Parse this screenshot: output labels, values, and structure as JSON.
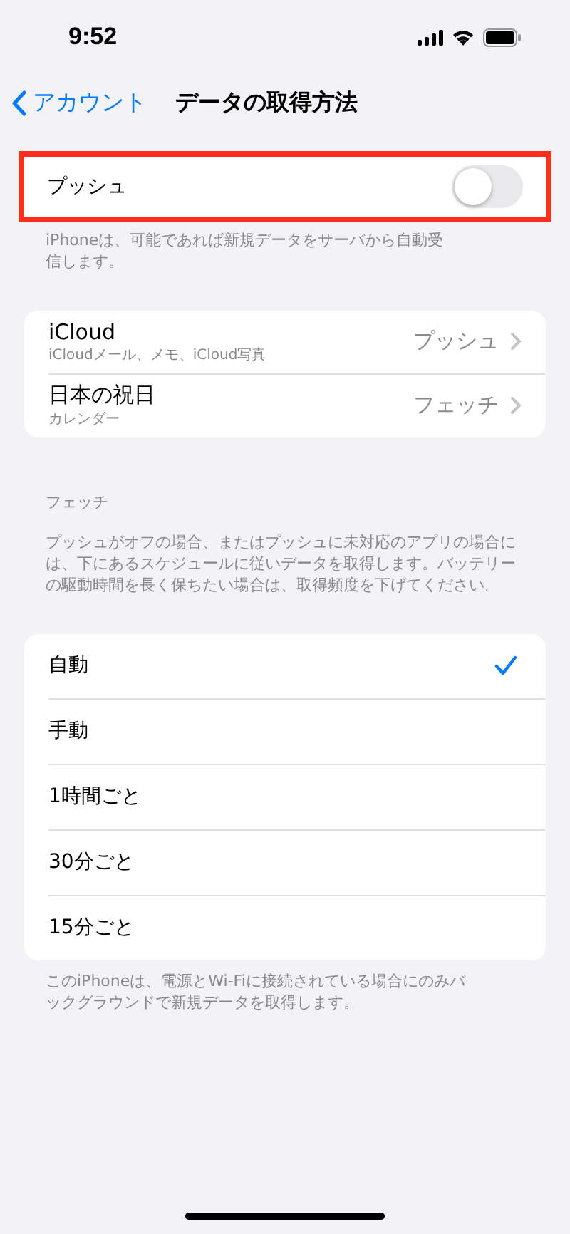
{
  "status_bar": {
    "time": "9:52"
  },
  "nav": {
    "back": "アカウント",
    "title": "データの取得方法"
  },
  "push": {
    "label": "プッシュ",
    "on": false,
    "highlighted": true,
    "footer": "iPhoneは、可能であれば新規データをサーバから自動受信します。"
  },
  "accounts": [
    {
      "name": "iCloud",
      "detail": "iCloudメール、メモ、iCloud写真",
      "value": "プッシュ"
    },
    {
      "name": "日本の祝日",
      "detail": "カレンダー",
      "value": "フェッチ"
    }
  ],
  "fetch": {
    "header": "フェッチ",
    "description": "プッシュがオフの場合、またはプッシュに未対応のアプリの場合には、下にあるスケジュールに従いデータを取得します。バッテリーの駆動時間を長く保ちたい場合は、取得頻度を下げてください。",
    "options": [
      {
        "label": "自動",
        "selected": true
      },
      {
        "label": "手動",
        "selected": false
      },
      {
        "label": "1時間ごと",
        "selected": false
      },
      {
        "label": "30分ごと",
        "selected": false
      },
      {
        "label": "15分ごと",
        "selected": false
      }
    ],
    "footer": "このiPhoneは、電源とWi-Fiに接続されている場合にのみバックグラウンドで新規データを取得します。"
  }
}
